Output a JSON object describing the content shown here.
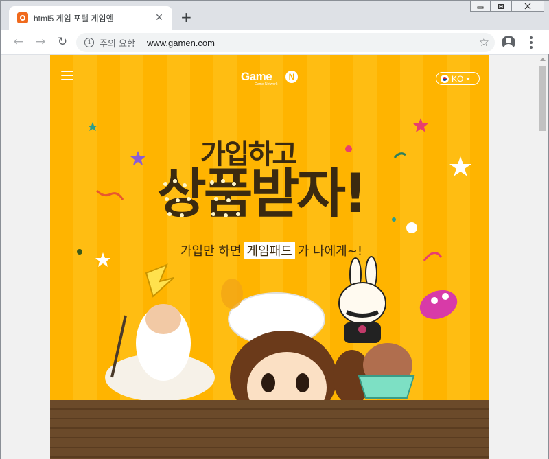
{
  "browser": {
    "tab": {
      "title": "html5 게임 포털 게임엔",
      "close_glyph": "✕"
    },
    "new_tab_glyph": "+",
    "window_buttons": {
      "minimize": "▭",
      "restore": "⧉",
      "close": "✕"
    },
    "toolbar": {
      "back_glyph": "←",
      "forward_glyph": "→",
      "reload_glyph": "↻",
      "security_icon_glyph": "i",
      "security_label": "주의 요함",
      "url": "www.gamen.com",
      "bookmark_glyph": "☆"
    }
  },
  "page": {
    "logo": {
      "text": "Game",
      "badge": "N",
      "sub": "Game Network"
    },
    "language": {
      "label": "KO"
    },
    "headline": {
      "line1": "가입하고",
      "line2": "상품받자!"
    },
    "subline": {
      "before": "가입만 하면",
      "highlight": "게임패드",
      "after": "가 나에게~!"
    },
    "colors": {
      "background_stripe_a": "#ffb400",
      "background_stripe_b": "#ffbd12",
      "headline": "#3b2a10",
      "floor": "#6b4a2a"
    },
    "icons": [
      "hamburger-icon",
      "flag-korea-icon",
      "star-icon",
      "confetti-icon"
    ]
  }
}
